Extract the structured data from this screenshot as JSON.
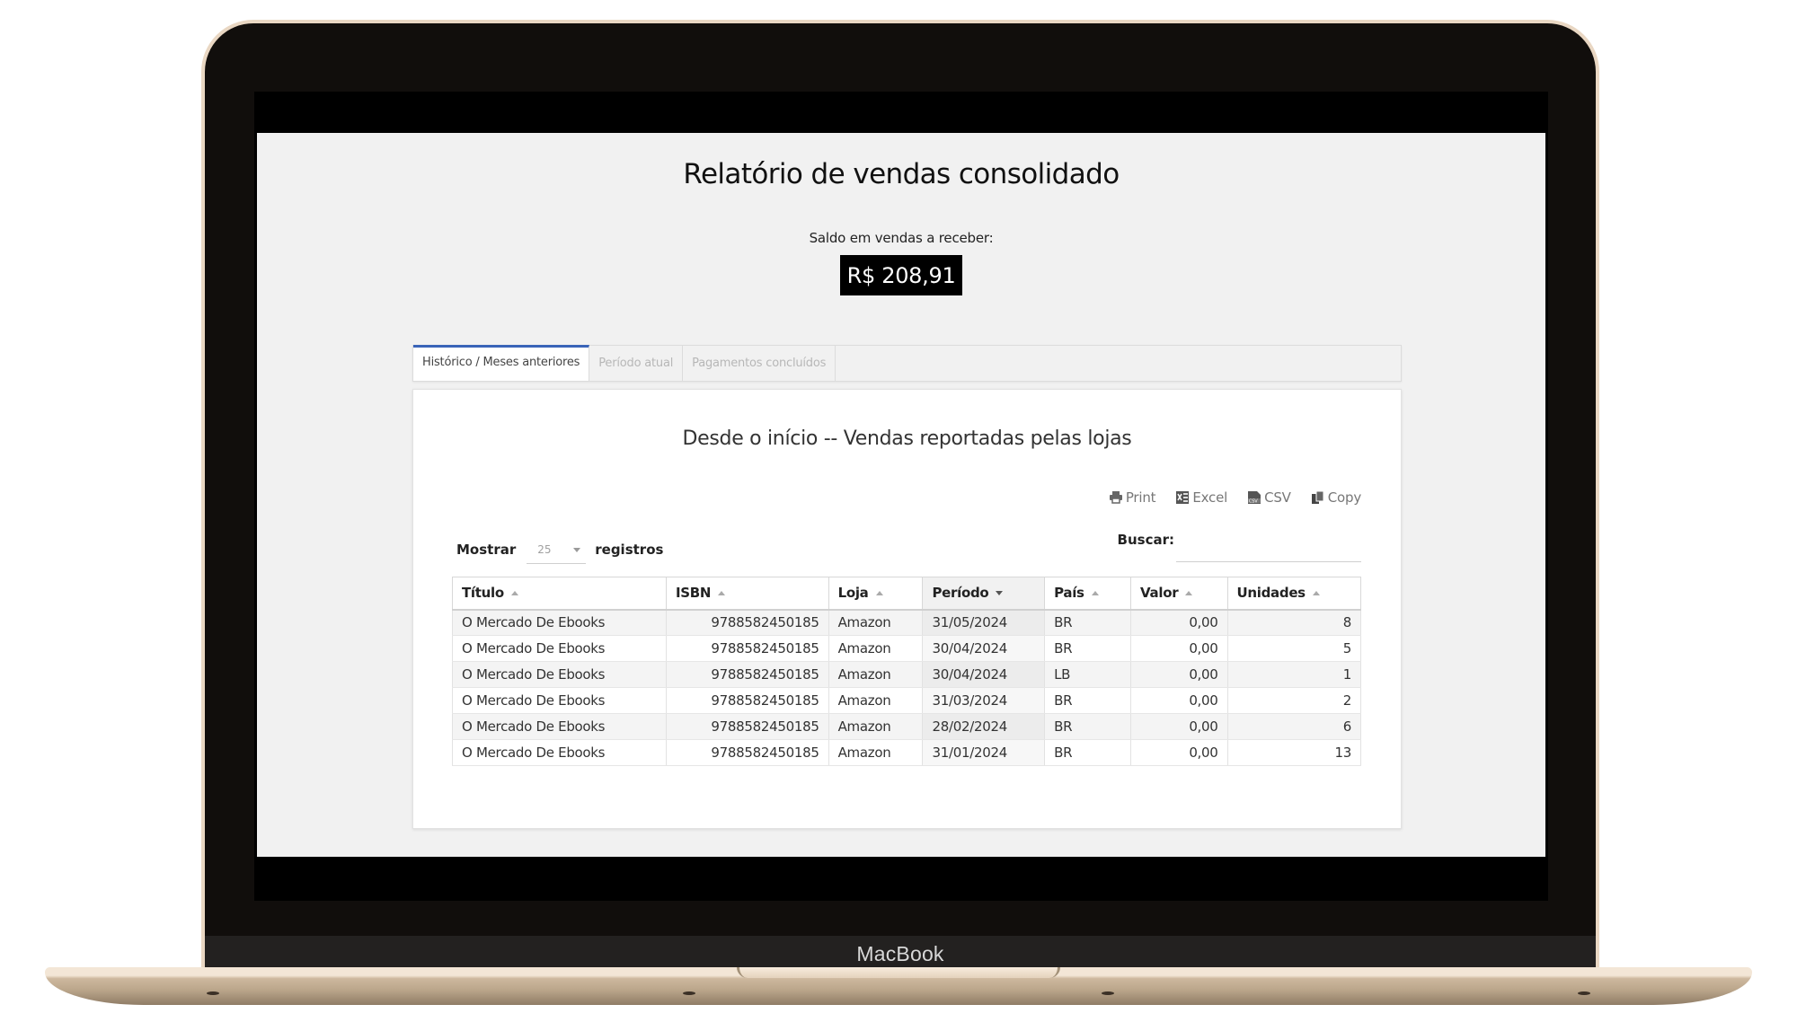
{
  "device": {
    "brand_label": "MacBook"
  },
  "page": {
    "title": "Relatório de vendas consolidado",
    "balance_label": "Saldo em vendas a receber:",
    "balance_value": "R$ 208,91"
  },
  "tabs": [
    {
      "label": "Histórico / Meses anteriores",
      "active": true
    },
    {
      "label": "Período atual",
      "active": false
    },
    {
      "label": "Pagamentos concluídos",
      "active": false
    }
  ],
  "report": {
    "title": "Desde o início -- Vendas reportadas pelas lojas",
    "toolbar": [
      {
        "label": "Print",
        "icon": "print-icon"
      },
      {
        "label": "Excel",
        "icon": "excel-icon"
      },
      {
        "label": "CSV",
        "icon": "csv-icon"
      },
      {
        "label": "Copy",
        "icon": "copy-icon"
      }
    ],
    "length": {
      "label_before": "Mostrar",
      "value": "25",
      "label_after": "registros"
    },
    "search": {
      "label": "Buscar:",
      "value": "",
      "placeholder": ""
    },
    "columns": [
      {
        "label": "Título",
        "sort": "asc"
      },
      {
        "label": "ISBN",
        "sort": "asc"
      },
      {
        "label": "Loja",
        "sort": "asc"
      },
      {
        "label": "Período",
        "sort": "desc"
      },
      {
        "label": "País",
        "sort": "asc"
      },
      {
        "label": "Valor",
        "sort": "asc"
      },
      {
        "label": "Unidades",
        "sort": "asc"
      }
    ],
    "rows": [
      [
        "O Mercado De Ebooks",
        "9788582450185",
        "Amazon",
        "31/05/2024",
        "BR",
        "0,00",
        "8"
      ],
      [
        "O Mercado De Ebooks",
        "9788582450185",
        "Amazon",
        "30/04/2024",
        "BR",
        "0,00",
        "5"
      ],
      [
        "O Mercado De Ebooks",
        "9788582450185",
        "Amazon",
        "30/04/2024",
        "LB",
        "0,00",
        "1"
      ],
      [
        "O Mercado De Ebooks",
        "9788582450185",
        "Amazon",
        "31/03/2024",
        "BR",
        "0,00",
        "2"
      ],
      [
        "O Mercado De Ebooks",
        "9788582450185",
        "Amazon",
        "28/02/2024",
        "BR",
        "0,00",
        "6"
      ],
      [
        "O Mercado De Ebooks",
        "9788582450185",
        "Amazon",
        "31/01/2024",
        "BR",
        "0,00",
        "13"
      ]
    ]
  },
  "colors": {
    "active_tab_accent": "#3a64b8",
    "balance_bg": "#000000",
    "balance_text": "#ffffff",
    "frame_gold": "#e9d7c3"
  }
}
